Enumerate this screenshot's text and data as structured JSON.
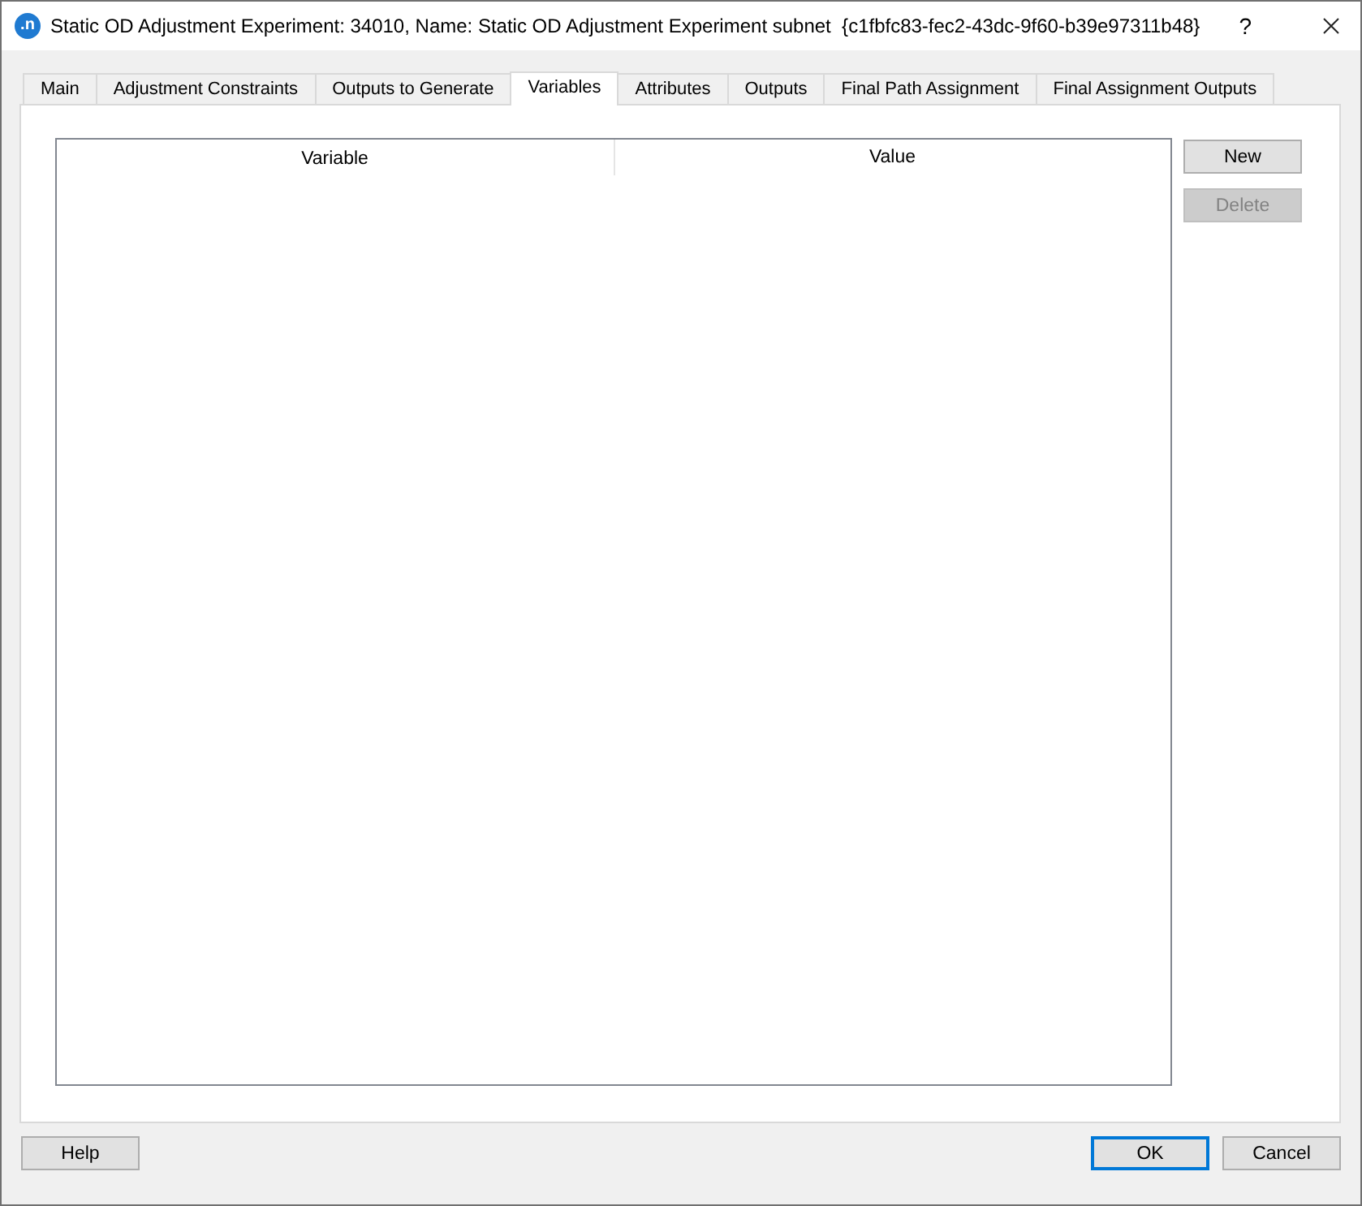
{
  "window": {
    "logo": ".n",
    "title": "Static OD Adjustment Experiment: 34010, Name: Static OD Adjustment Experiment subnet  {c1fbfc83-fec2-43dc-9f60-b39e97311b48}",
    "help": "?"
  },
  "tabs": [
    {
      "label": "Main",
      "selected": false
    },
    {
      "label": "Adjustment Constraints",
      "selected": false
    },
    {
      "label": "Outputs to Generate",
      "selected": false
    },
    {
      "label": "Variables",
      "selected": true
    },
    {
      "label": "Attributes",
      "selected": false
    },
    {
      "label": "Outputs",
      "selected": false
    },
    {
      "label": "Final Path Assignment",
      "selected": false
    },
    {
      "label": "Final Assignment Outputs",
      "selected": false
    }
  ],
  "table": {
    "columns": [
      "Variable",
      "Value"
    ]
  },
  "side_buttons": [
    {
      "label": "New",
      "disabled": false
    },
    {
      "label": "Delete",
      "disabled": true
    }
  ],
  "help_button": {
    "label": "Help",
    "focused": false
  },
  "footer_buttons": [
    {
      "label": "OK",
      "focused": true
    },
    {
      "label": "Cancel",
      "focused": false
    }
  ]
}
